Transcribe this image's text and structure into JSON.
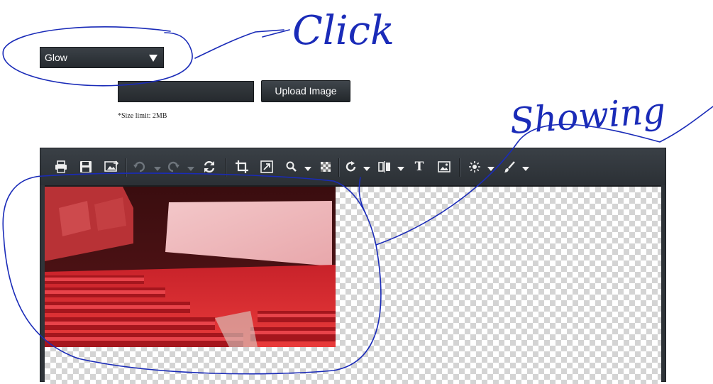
{
  "effect_select": {
    "value": "Glow"
  },
  "upload": {
    "button_label": "Upload Image",
    "size_note": "*Size limit: 2MB"
  },
  "toolbar": {
    "tools": [
      "print-icon",
      "save-icon",
      "export-icon",
      "undo-icon",
      "redo-icon",
      "reset-icon",
      "crop-icon",
      "resize-icon",
      "zoom-icon",
      "transparency-icon",
      "rotate-icon",
      "flip-icon",
      "text-icon",
      "insert-image-icon",
      "brightness-icon",
      "brush-icon"
    ],
    "text_tool_label": "T"
  },
  "annotations": {
    "click_note": "Click",
    "showing_note": "Showing",
    "ink_color": "#1a2bb8"
  },
  "colors": {
    "dark_ui": "#2f3439",
    "button": "#3b4147"
  }
}
